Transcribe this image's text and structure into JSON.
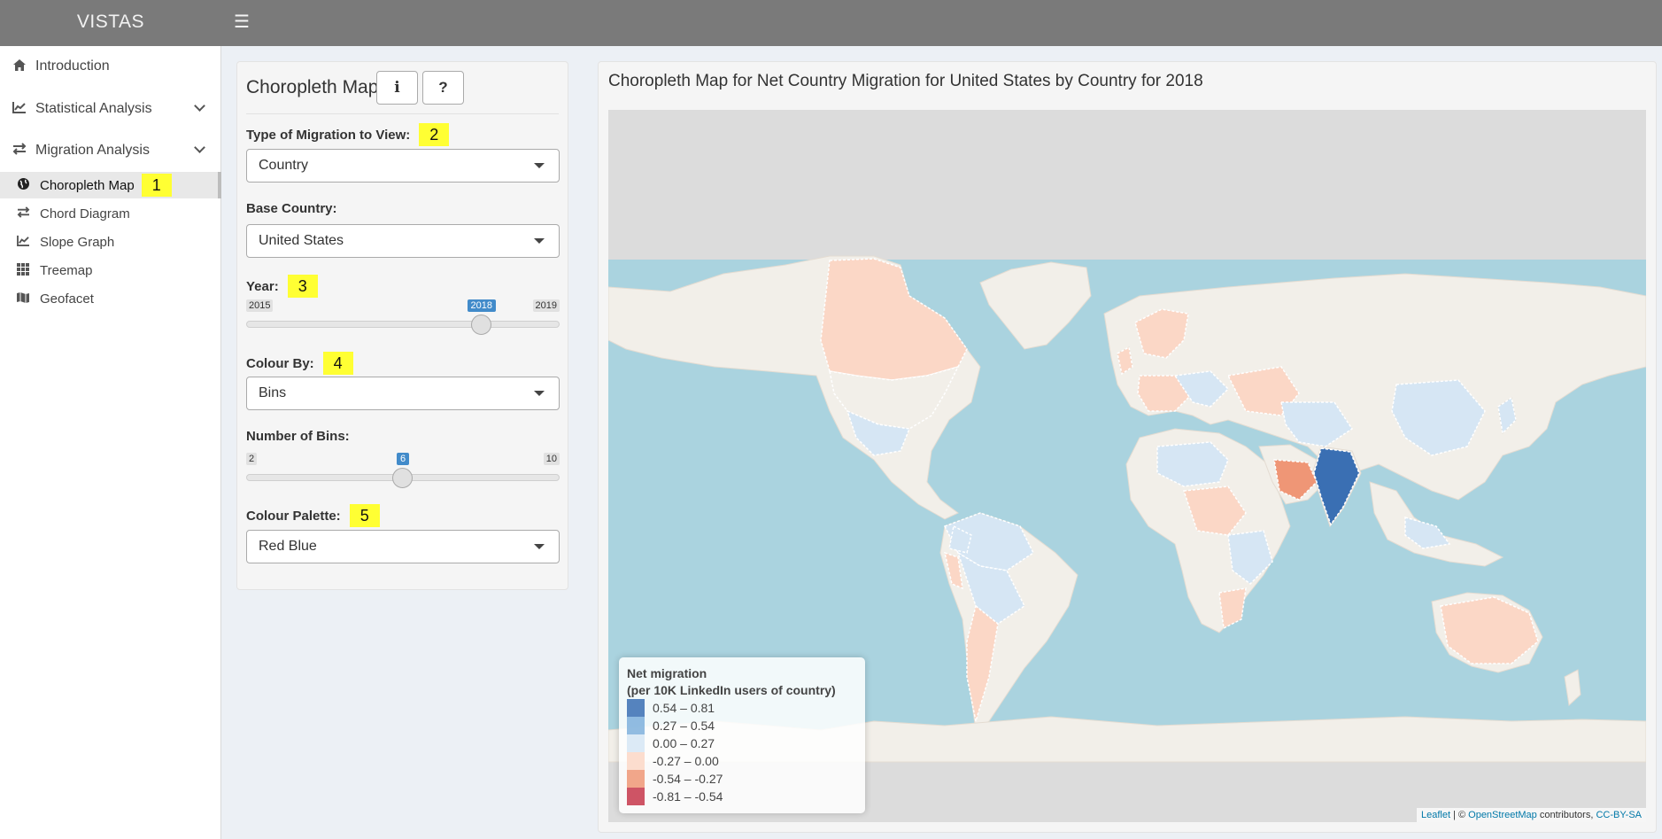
{
  "header": {
    "app_title": "VISTAS",
    "menu_toggle_icon": "hamburger-icon"
  },
  "sidebar": {
    "items": [
      {
        "label": "Introduction",
        "icon": "home-icon"
      },
      {
        "label": "Statistical Analysis",
        "icon": "line-chart-icon"
      },
      {
        "label": "Migration Analysis",
        "icon": "exchange-icon"
      }
    ],
    "sub_items": [
      {
        "label": "Choropleth Map",
        "icon": "globe-icon",
        "active": true,
        "highlight": "1"
      },
      {
        "label": "Chord Diagram",
        "icon": "exchange-icon"
      },
      {
        "label": "Slope Graph",
        "icon": "line-chart-icon"
      },
      {
        "label": "Treemap",
        "icon": "grid-icon"
      },
      {
        "label": "Geofacet",
        "icon": "map-icon"
      }
    ]
  },
  "controls": {
    "title": "Choropleth Map",
    "info_button": "i",
    "help_button": "?",
    "migration_type": {
      "label": "Type of Migration to View:",
      "highlight": "2",
      "value": "Country"
    },
    "base_country": {
      "label": "Base Country:",
      "value": "United States"
    },
    "year": {
      "label": "Year:",
      "highlight": "3",
      "min": "2015",
      "max": "2019",
      "value": "2018",
      "fraction": 0.75
    },
    "colour_by": {
      "label": "Colour By:",
      "highlight": "4",
      "value": "Bins"
    },
    "bins": {
      "label": "Number of Bins:",
      "min": "2",
      "max": "10",
      "value": "6",
      "fraction": 0.5
    },
    "palette": {
      "label": "Colour Palette:",
      "highlight": "5",
      "value": "Red Blue"
    }
  },
  "map": {
    "title": "Choropleth Map for Net Country Migration for United States by Country for 2018",
    "colors": {
      "ocean": "#aad3df",
      "land": "#f2efe9",
      "frame": "#dcdcdc"
    },
    "legend": {
      "title_line1": "Net migration",
      "title_line2": "(per 10K LinkedIn users of country)",
      "bins": [
        {
          "label": "0.54 – 0.81",
          "color": "#3a6fb3"
        },
        {
          "label": "0.27 – 0.54",
          "color": "#7fb0dc"
        },
        {
          "label": "0.00 – 0.27",
          "color": "#d6e6f4"
        },
        {
          "label": "-0.27 – 0.00",
          "color": "#fbd7c6"
        },
        {
          "label": "-0.54 – -0.27",
          "color": "#ef9676"
        },
        {
          "label": "-0.81 – -0.54",
          "color": "#c5364a"
        }
      ]
    },
    "attribution": {
      "leaflet": "Leaflet",
      "sep": " | © ",
      "osm": "OpenStreetMap",
      "contrib": " contributors, ",
      "license": "CC-BY-SA"
    }
  }
}
